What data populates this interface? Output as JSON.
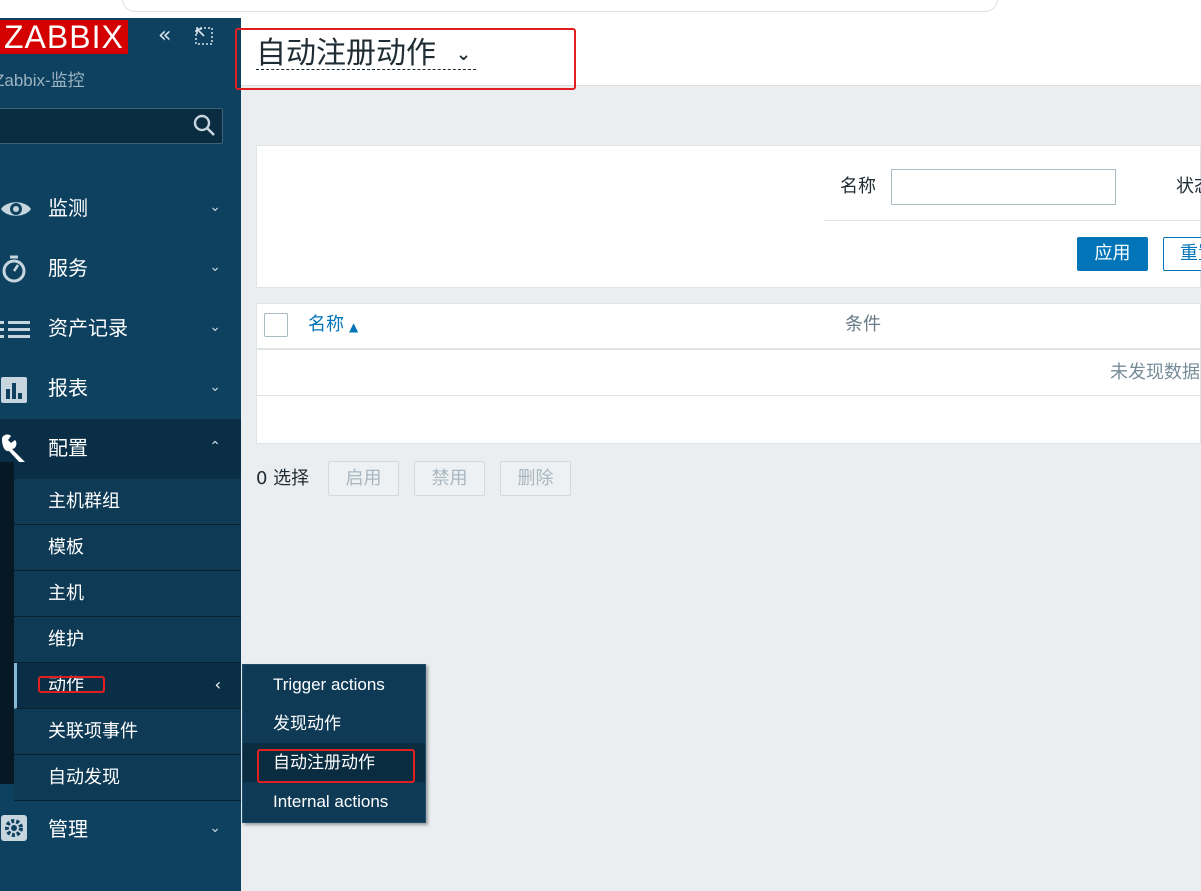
{
  "app": {
    "logo_text": "ZABBIX",
    "server_name": "Zabbix-监控",
    "collapse_glyph": "«",
    "page_title": "自动注册动作",
    "colors": {
      "sidebar": "#0e4160",
      "accent": "#0275b8",
      "logo": "#d40000",
      "highlight_box": "#e02020"
    }
  },
  "search": {
    "placeholder": ""
  },
  "nav": {
    "items": [
      {
        "label": "监测",
        "icon": "eye-icon",
        "chevron": "⌄"
      },
      {
        "label": "服务",
        "icon": "stopwatch-icon",
        "chevron": "⌄"
      },
      {
        "label": "资产记录",
        "icon": "list-icon",
        "chevron": "⌄"
      },
      {
        "label": "报表",
        "icon": "bar-chart-icon",
        "chevron": "⌄"
      },
      {
        "label": "配置",
        "icon": "wrench-icon",
        "chevron": "⌃"
      },
      {
        "label": "管理",
        "icon": "gear-icon",
        "chevron": "⌄"
      }
    ],
    "config_submenu": [
      {
        "label": "主机群组"
      },
      {
        "label": "模板"
      },
      {
        "label": "主机"
      },
      {
        "label": "维护"
      },
      {
        "label": "动作",
        "chevron": "‹"
      },
      {
        "label": "关联项事件"
      },
      {
        "label": "自动发现"
      }
    ],
    "actions_flyout": [
      {
        "label": "Trigger actions"
      },
      {
        "label": "发现动作"
      },
      {
        "label": "自动注册动作"
      },
      {
        "label": "Internal actions"
      }
    ]
  },
  "filter": {
    "name_label": "名称",
    "name_value": "",
    "status_label": "状态",
    "apply_label": "应用",
    "reset_label": "重置"
  },
  "table": {
    "columns": [
      "名称",
      "条件"
    ],
    "sort_indicator": "▲",
    "empty_text": "未发现数据"
  },
  "actions_bar": {
    "selected_count": "0 选择",
    "enable_label": "启用",
    "disable_label": "禁用",
    "delete_label": "删除"
  }
}
